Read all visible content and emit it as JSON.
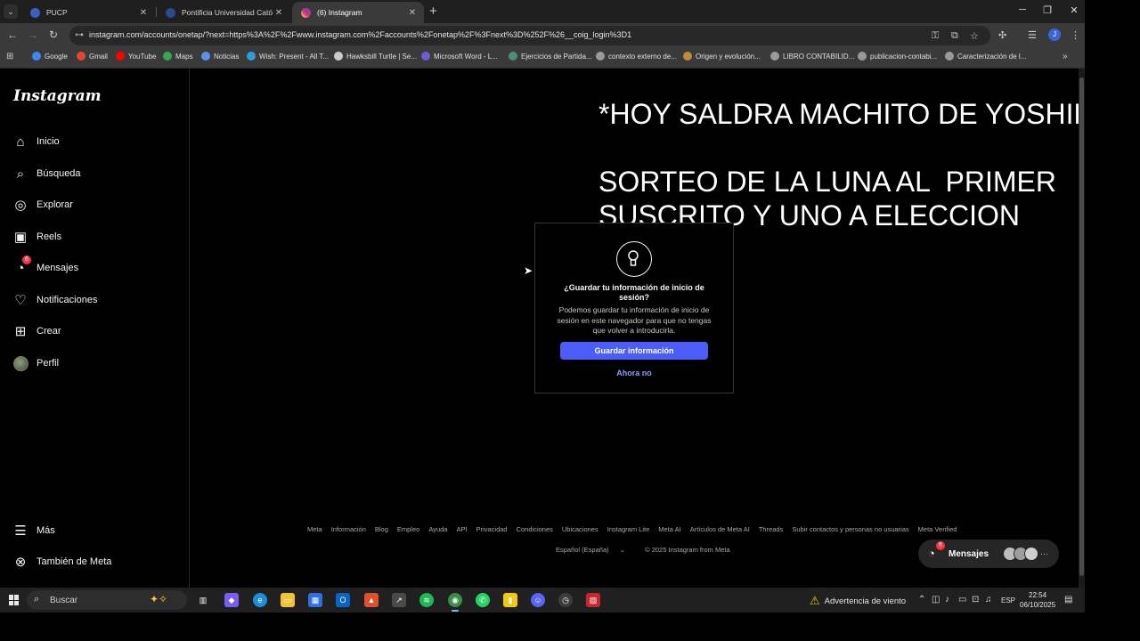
{
  "browser": {
    "tabs": [
      {
        "title": "PUCP",
        "active": false,
        "favicon_color": "#3b5fbf"
      },
      {
        "title": "Pontificia Universidad Católica",
        "active": false,
        "favicon_color": "#2c4a8a"
      },
      {
        "title": "(6) Instagram",
        "active": true,
        "favicon_color": "#d6249f"
      }
    ],
    "url": "instagram.com/accounts/onetap/?next=https%3A%2F%2Fwww.instagram.com%2Faccounts%2Fonetap%2F%3Fnext%3D%252F%26__coig_login%3D1",
    "profile_initial": "J",
    "bookmarks": [
      {
        "label": "Google",
        "color": "#4285f4"
      },
      {
        "label": "Gmail",
        "color": "#ea4335"
      },
      {
        "label": "YouTube",
        "color": "#ff0000"
      },
      {
        "label": "Maps",
        "color": "#34a853"
      },
      {
        "label": "Noticias",
        "color": "#5f8fe8"
      },
      {
        "label": "Wish: Present - All T...",
        "color": "#2d9cdb"
      },
      {
        "label": "Hawksbill Turtle | Se...",
        "color": "#cccccc"
      },
      {
        "label": "Microsoft Word - L...",
        "color": "#6f5bd8"
      },
      {
        "label": "Ejercicios de Partida...",
        "color": "#4a8f6e"
      },
      {
        "label": "contexto externo de...",
        "color": "#9a9a9a"
      },
      {
        "label": "Origen y evolución...",
        "color": "#c48a3a"
      },
      {
        "label": "LIBRO CONTABILID...",
        "color": "#9a9a9a"
      },
      {
        "label": "publicacion-contabi...",
        "color": "#9a9a9a"
      },
      {
        "label": "Caracterización de l...",
        "color": "#9a9a9a"
      }
    ]
  },
  "instagram": {
    "logo": "Instagram",
    "nav": [
      {
        "label": "Inicio",
        "icon": "home-icon",
        "glyph": "⌂"
      },
      {
        "label": "Búsqueda",
        "icon": "search-icon",
        "glyph": "⌕"
      },
      {
        "label": "Explorar",
        "icon": "compass-icon",
        "glyph": "◎"
      },
      {
        "label": "Reels",
        "icon": "reels-icon",
        "glyph": "▣"
      },
      {
        "label": "Mensajes",
        "icon": "messenger-icon",
        "glyph": "◔",
        "badge": "6"
      },
      {
        "label": "Notificaciones",
        "icon": "heart-icon",
        "glyph": "♡"
      },
      {
        "label": "Crear",
        "icon": "plus-square-icon",
        "glyph": "⊞"
      },
      {
        "label": "Perfil",
        "icon": "avatar",
        "glyph": ""
      }
    ],
    "bottom_nav": [
      {
        "label": "Más",
        "icon": "menu-icon",
        "glyph": "☰"
      },
      {
        "label": "También de Meta",
        "icon": "meta-icon",
        "glyph": "⊗"
      }
    ],
    "overlay_text": "*HOY SALDRA MACHITO DE YOSHIRO*\n\nSORTEO DE LA LUNA AL  PRIMER\nSUSCRITO Y UNO A ELECCION",
    "dialog": {
      "question": "¿Guardar tu información de inicio de sesión?",
      "description": "Podemos guardar tu información de inicio de sesión en este navegador para que no tengas que volver a introducirla.",
      "primary": "Guardar información",
      "secondary": "Ahora no"
    },
    "footer_links": [
      "Meta",
      "Información",
      "Blog",
      "Empleo",
      "Ayuda",
      "API",
      "Privacidad",
      "Condiciones",
      "Ubicaciones",
      "Instagram Lite",
      "Meta AI",
      "Artículos de Meta AI",
      "Threads",
      "Subir contactos y personas no usuarias",
      "Meta Verified"
    ],
    "language": "Español (España)",
    "copyright": "© 2025 Instagram from Meta",
    "messages_pill": {
      "label": "Mensajes",
      "badge": "6"
    }
  },
  "taskbar": {
    "search_placeholder": "Buscar",
    "apps": [
      {
        "name": "task-view",
        "color": "#3a3a3a",
        "glyph": "▥"
      },
      {
        "name": "copilot",
        "color": "#7b5cf0",
        "glyph": "◆"
      },
      {
        "name": "edge",
        "color": "#1d8fd8",
        "glyph": "e"
      },
      {
        "name": "file-explorer",
        "color": "#f1c232",
        "glyph": "▭"
      },
      {
        "name": "store",
        "color": "#2f6fe0",
        "glyph": "▦"
      },
      {
        "name": "outlook",
        "color": "#0a64c8",
        "glyph": "O"
      },
      {
        "name": "brave",
        "color": "#e0502b",
        "glyph": "▲"
      },
      {
        "name": "stocks",
        "color": "#4a4a4a",
        "glyph": "↗"
      },
      {
        "name": "spotify",
        "color": "#1db954",
        "glyph": "≋"
      },
      {
        "name": "chrome",
        "color": "#3a8d45",
        "glyph": "◉",
        "active": true
      },
      {
        "name": "whatsapp",
        "color": "#25d366",
        "glyph": "✆"
      },
      {
        "name": "power-bi",
        "color": "#f2c811",
        "glyph": "▮"
      },
      {
        "name": "discord",
        "color": "#5865f2",
        "glyph": "☺"
      },
      {
        "name": "clock-app",
        "color": "#3c3c3c",
        "glyph": "◷"
      },
      {
        "name": "red-app",
        "color": "#c8262b",
        "glyph": "▨"
      }
    ],
    "weather": "Advertencia de viento",
    "language": "ESP",
    "time": "22:54",
    "date": "06/10/2025"
  }
}
